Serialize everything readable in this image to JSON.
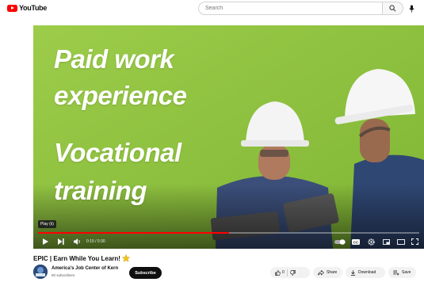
{
  "header": {
    "logo_text": "YouTube",
    "search_placeholder": "Search"
  },
  "video": {
    "overlay_lines": [
      "Paid work",
      "experience",
      "Vocational",
      "training"
    ],
    "tooltip": "Play (k)",
    "time": "0:15 / 0:30",
    "progress": 0.5
  },
  "details": {
    "title": "EPIC | Earn While You Learn!",
    "channel": "America's Job Center of Kern",
    "subscribers": "80 subscribers",
    "subscribe_label": "Subscribe",
    "like_count": "0",
    "share_label": "Share",
    "download_label": "Download",
    "save_label": "Save"
  },
  "colors": {
    "brand_red": "#ff0000",
    "video_green": "#8cc63f",
    "progress_red": "#ff0000"
  },
  "icons": [
    "youtube-logo-icon",
    "search-icon",
    "mic-icon",
    "play-icon",
    "next-icon",
    "volume-icon",
    "autoplay-icon",
    "cc-icon",
    "settings-icon",
    "miniplayer-icon",
    "theater-icon",
    "fullscreen-icon",
    "star-emoji-icon",
    "thumbs-up-icon",
    "thumbs-down-icon",
    "share-icon",
    "download-icon",
    "save-icon"
  ]
}
